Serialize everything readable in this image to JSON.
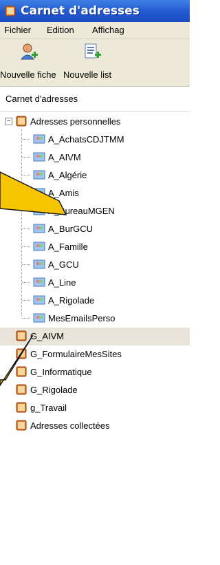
{
  "window": {
    "title": "Carnet d'adresses"
  },
  "menu": [
    {
      "label": "Fichier",
      "accel": "F"
    },
    {
      "label": "Edition",
      "accel": "E"
    },
    {
      "label": "Affichag",
      "accel": "c"
    }
  ],
  "toolbar": {
    "new_card": {
      "label": "Nouvelle fiche",
      "icon": "new-contact-icon"
    },
    "new_list": {
      "label": "Nouvelle list",
      "icon": "new-list-icon"
    }
  },
  "pane": {
    "header": "Carnet d'adresses"
  },
  "tree": {
    "root": {
      "label": "Adresses personnelles",
      "expanded": true,
      "icon": "address-book-icon"
    },
    "lists": [
      "A_AchatsCDJTMM",
      "A_AIVM",
      "A_Algérie",
      "A_Amis",
      "A_BureauMGEN",
      "A_BurGCU",
      "A_Famille",
      "A_GCU",
      "A_Line",
      "A_Rigolade",
      "MesEmailsPerso"
    ],
    "books": [
      "G_AIVM",
      "G_FormulaireMesSites",
      "G_Informatique",
      "G_Rigolade",
      "g_Travail",
      "Adresses collectées"
    ],
    "selected": "G_AIVM"
  },
  "colors": {
    "titlebar": "#2258cf",
    "callout_fill": "#f6c400",
    "callout_stroke": "#1a1a1a",
    "selection": "#e8e4d9"
  }
}
